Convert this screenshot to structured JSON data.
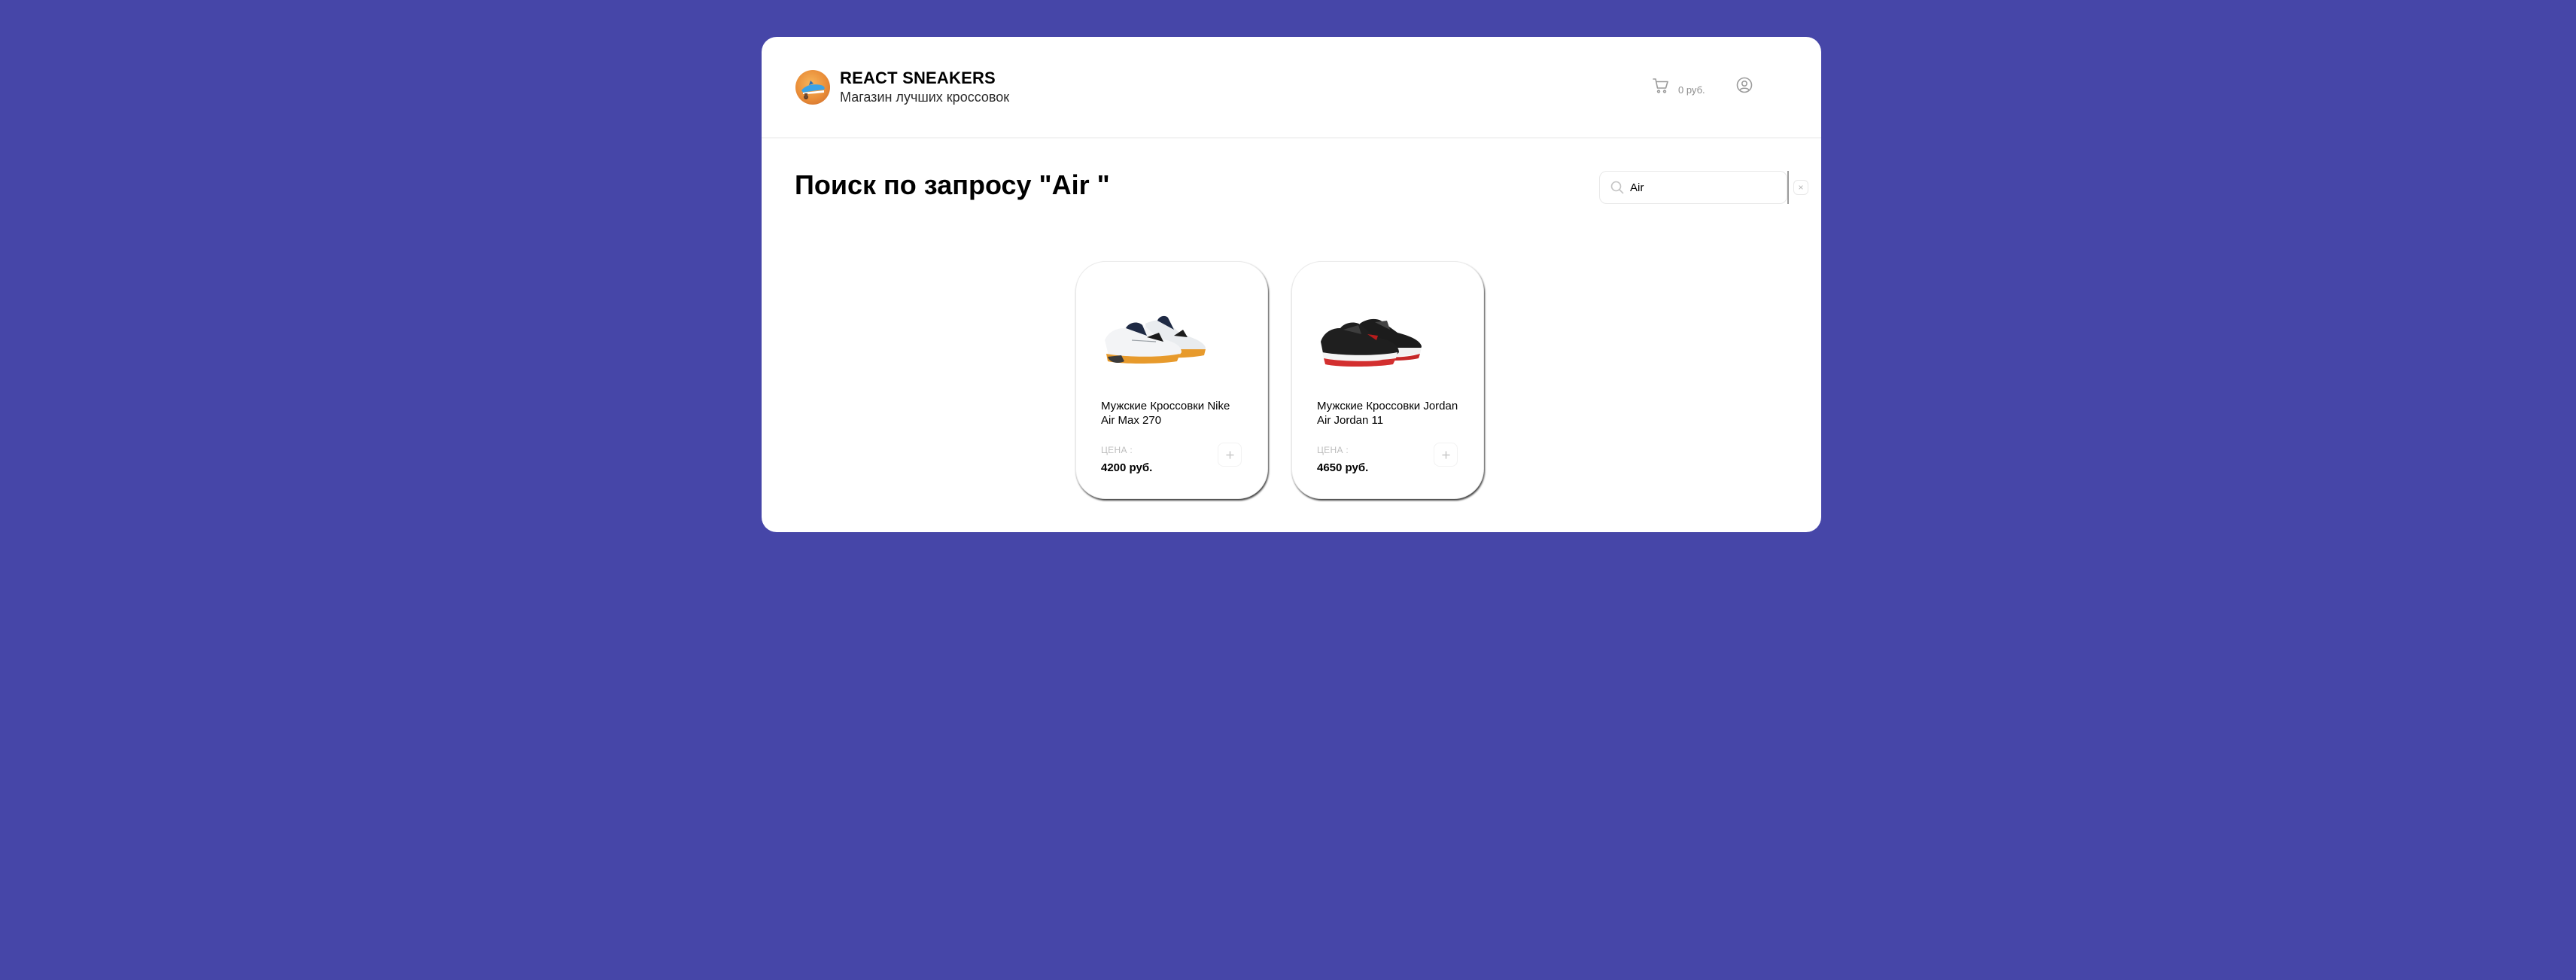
{
  "header": {
    "brand_title": "REACT SNEAKERS",
    "brand_subtitle": "Магазин лучших кроссовок",
    "cart_total": "0 руб.",
    "cart_icon": "cart-icon",
    "profile_icon": "user-icon",
    "logo_icon": "logo-icon"
  },
  "main": {
    "title": "Поиск по запросу \"Air \"",
    "search": {
      "value": "Air",
      "icon": "search-icon",
      "clear_label": "×"
    }
  },
  "products": [
    {
      "name": "Мужские Кроссовки Nike Air Max 270",
      "price_label": "ЦЕНА :",
      "price": "4200 руб.",
      "add_label": "+",
      "image_icon": "sneaker-image"
    },
    {
      "name": "Мужские Кроссовки Jordan Air Jordan 11",
      "price_label": "ЦЕНА :",
      "price": "4650 руб.",
      "add_label": "+",
      "image_icon": "sneaker-image"
    }
  ],
  "colors": {
    "background": "#4646a8",
    "panel": "#ffffff",
    "muted_text": "#bdbdbd"
  }
}
